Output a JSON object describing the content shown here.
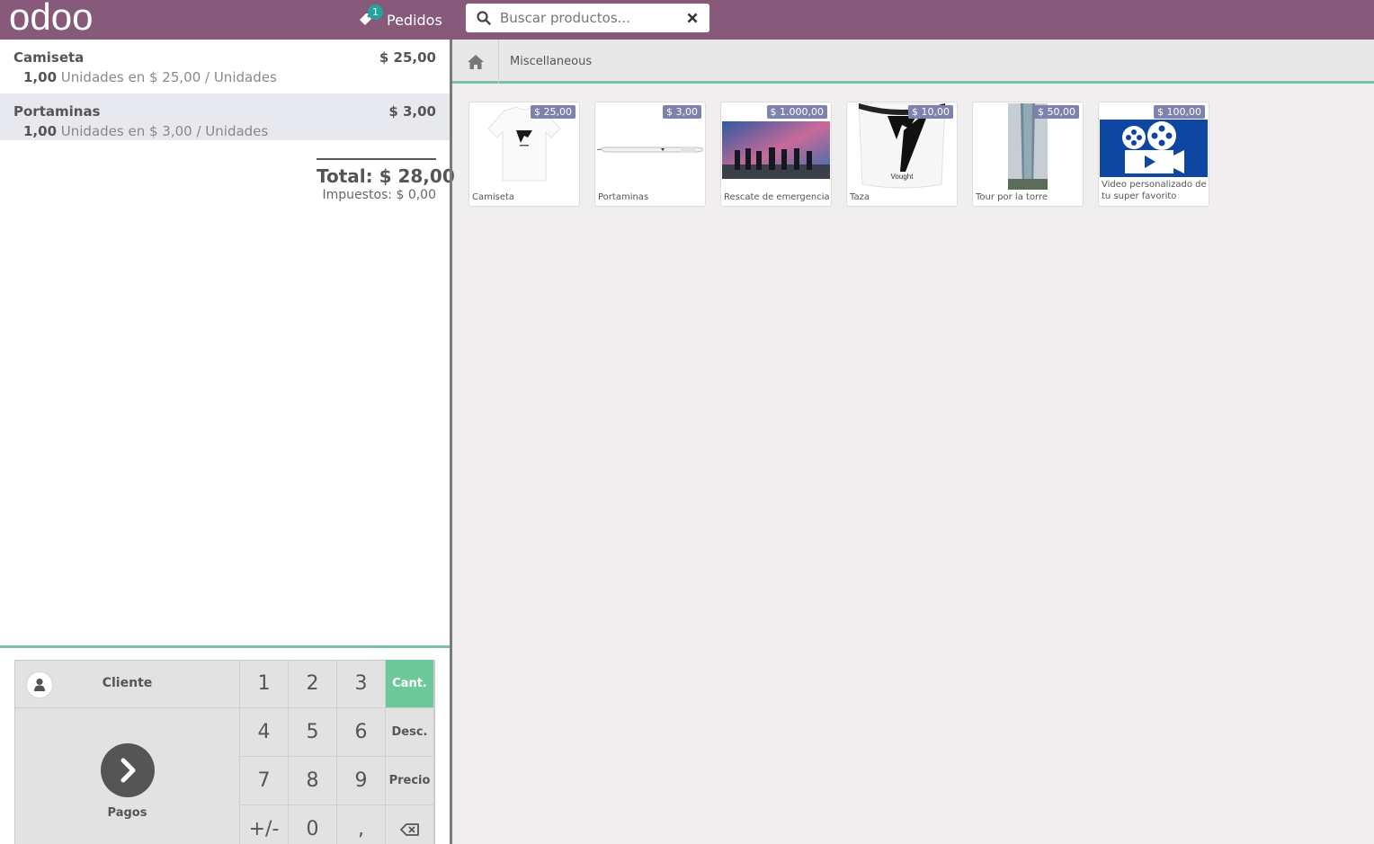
{
  "header": {
    "logo_text": "odoo",
    "orders_count": "1",
    "orders_label": "Pedidos",
    "search_placeholder": "Buscar productos..."
  },
  "order": {
    "lines": [
      {
        "name": "Camiseta",
        "price": "$ 25,00",
        "qty": "1,00",
        "info": " Unidades en $ 25,00 / Unidades"
      },
      {
        "name": "Portaminas",
        "price": "$ 3,00",
        "qty": "1,00",
        "info": " Unidades en $ 3,00 / Unidades"
      }
    ],
    "total": "Total: $ 28,00",
    "taxes": "Impuestos: $ 0,00"
  },
  "control": {
    "client_label": "Cliente",
    "pay_label": "Pagos",
    "keys": [
      "1",
      "2",
      "3",
      "4",
      "5",
      "6",
      "7",
      "8",
      "9",
      "+/-",
      "0",
      ","
    ],
    "modes": [
      "Cant.",
      "Desc.",
      "Precio"
    ],
    "active_mode": "Cant."
  },
  "breadcrumb": {
    "category": "Miscellaneous"
  },
  "products": [
    {
      "name": "Camiseta",
      "price": "$ 25,00",
      "image": "tshirt-image"
    },
    {
      "name": "Portaminas",
      "price": "$ 3,00",
      "image": "pencil-image"
    },
    {
      "name": "Rescate de emergencia",
      "price": "$ 1.000,00",
      "image": "heroes-image"
    },
    {
      "name": "Taza",
      "price": "$ 10,00",
      "image": "mug-image"
    },
    {
      "name": "Tour por la torre",
      "price": "$ 50,00",
      "image": "tower-image"
    },
    {
      "name": "Video personalizado de tu super favorito",
      "price": "$ 100,00",
      "image": "video-camera-image"
    }
  ],
  "colors": {
    "header": "#875a7b",
    "accent": "#7ac1a3",
    "badge": "#22a39b",
    "price_tag": "#7f82ac",
    "active_key": "#6ec89b"
  }
}
